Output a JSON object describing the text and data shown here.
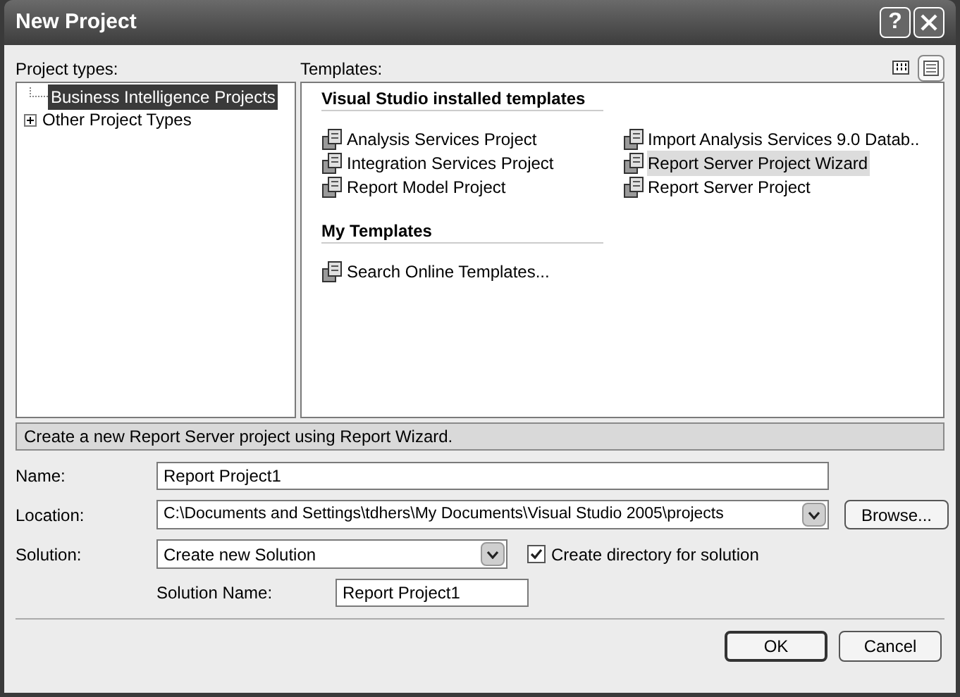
{
  "window": {
    "title": "New Project",
    "help_button": "?"
  },
  "project_types": {
    "label": "Project types:",
    "items": [
      {
        "label": "Business Intelligence Projects",
        "selected": true,
        "expandable": false
      },
      {
        "label": "Other Project Types",
        "selected": false,
        "expandable": true
      }
    ]
  },
  "templates": {
    "label": "Templates:",
    "views": [
      {
        "kind": "large",
        "selected": false
      },
      {
        "kind": "small",
        "selected": true
      }
    ],
    "groups": [
      {
        "title": "Visual Studio installed templates",
        "items": [
          {
            "label": "Analysis Services Project",
            "selected": false
          },
          {
            "label": "Import Analysis Services 9.0 Datab..",
            "selected": false
          },
          {
            "label": "Integration Services Project",
            "selected": false
          },
          {
            "label": "Report Server Project Wizard",
            "selected": true
          },
          {
            "label": "Report Model Project",
            "selected": false
          },
          {
            "label": "Report Server Project",
            "selected": false
          }
        ]
      },
      {
        "title": "My Templates",
        "items": [
          {
            "label": "Search Online Templates...",
            "selected": false
          }
        ]
      }
    ]
  },
  "description": "Create a new Report Server project using Report Wizard.",
  "form": {
    "name": {
      "label": "Name:",
      "value": "Report Project1"
    },
    "location": {
      "label": "Location:",
      "value": "C:\\Documents and Settings\\tdhers\\My Documents\\Visual Studio 2005\\projects",
      "browse": "Browse..."
    },
    "solution": {
      "label": "Solution:",
      "value": "Create new Solution"
    },
    "create_directory": {
      "label": "Create directory for solution",
      "checked": true
    },
    "solution_name": {
      "label": "Solution Name:",
      "value": "Report Project1"
    }
  },
  "buttons": [
    "OK",
    "Cancel"
  ]
}
